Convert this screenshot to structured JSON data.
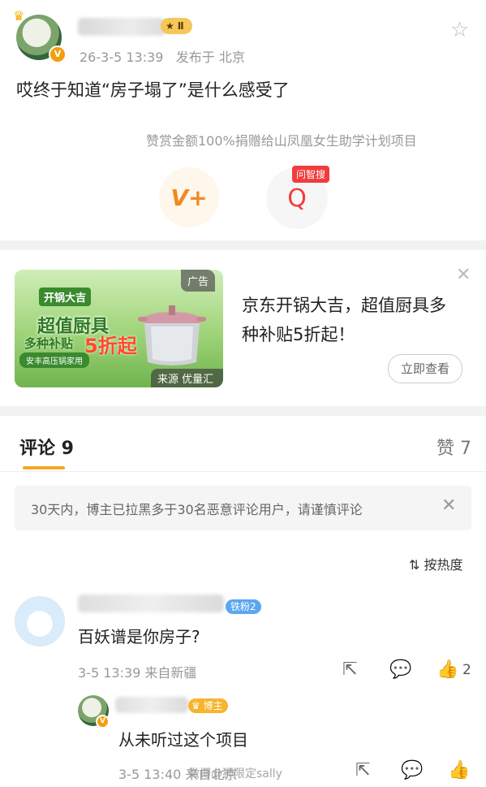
{
  "post": {
    "level_badge": "Ⅱ",
    "v_badge": "V",
    "time": "26-3-5 13:39",
    "location": "发布于 北京",
    "text": "哎终于知道“房子塌了”是什么感受了",
    "donate_text": "赞赏金额100%捐赠给山凤凰女生助学计划项目",
    "wen_tag": "问智搜"
  },
  "ad": {
    "label": "广告",
    "img_title1": "开锅大吉",
    "img_title2": "超值厨具",
    "img_title3": "多种补贴",
    "img_discount": "5折起",
    "img_tag": "安丰高压锅家用",
    "source": "来源  优量汇",
    "desc": "京东开锅大吉，超值厨具多种补贴5折起！",
    "button": "立即查看"
  },
  "tabs": {
    "comments": "评论 9",
    "likes": "赞 7"
  },
  "notice": "30天内，博主已拉黑多于30名恶意评论用户，请谨慎评论",
  "sort_label": "按热度",
  "comment1": {
    "fan_badge": "铁粉2",
    "text": "百妖谱是你房子?",
    "meta": "3-5 13:39  来自新疆",
    "likes": "2"
  },
  "reply": {
    "author_badge": "博主",
    "text": "从未听过这个项目",
    "meta": "3-5 13:40  来自北京"
  },
  "watermark": "微博@狮限定sally",
  "icons": {
    "star": "star-icon",
    "close": "close-icon",
    "share": "share-icon",
    "reply": "comment-icon",
    "like": "thumbs-up-icon",
    "sort": "sort-icon"
  }
}
